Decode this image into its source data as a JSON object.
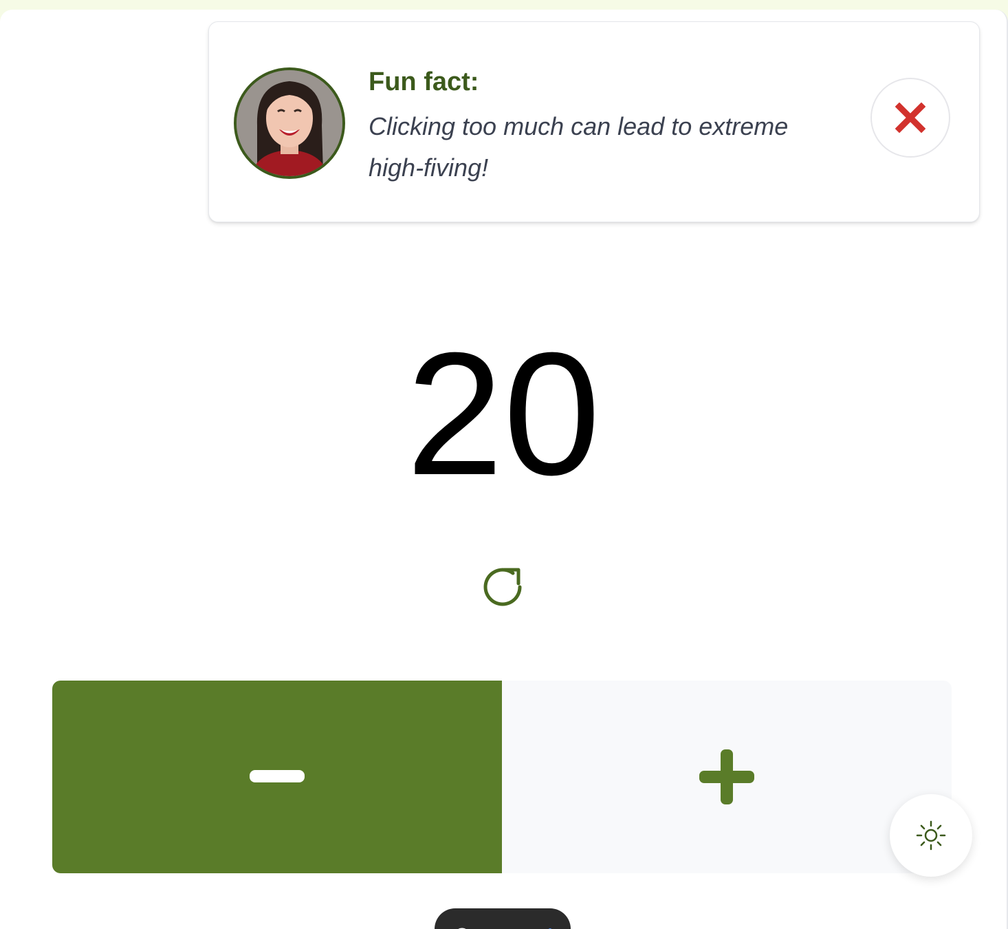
{
  "toast": {
    "title": "Fun fact:",
    "message": "Clicking too much can lead to extreme high-fiving!",
    "close_icon": "close-x-icon",
    "close_color": "#d2322d"
  },
  "counter": {
    "value": "20"
  },
  "controls": {
    "reset_icon": "refresh-icon",
    "decrement_icon": "minus-icon",
    "increment_icon": "plus-icon",
    "theme_icon": "sun-icon"
  },
  "colors": {
    "accent": "#5a7c29",
    "accent_dark": "#3c5a1c",
    "page_background": "#f6fbe6",
    "increment_background": "#f8f9fb"
  }
}
